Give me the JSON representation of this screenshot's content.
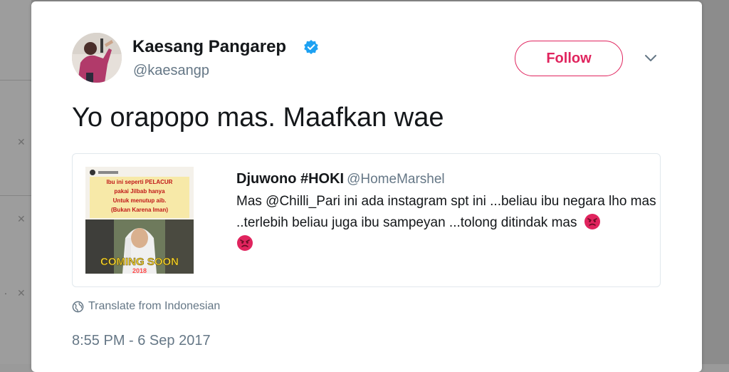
{
  "tweet": {
    "author_name": "Kaesang Pangarep",
    "author_handle": "@kaesangp",
    "follow_label": "Follow",
    "text": "Yo orapopo mas. Maafkan wae",
    "translate_label": "Translate from Indonesian",
    "timestamp": "8:55 PM - 6 Sep 2017"
  },
  "quoted_tweet": {
    "author_name": "Djuwono #HOKI",
    "author_handle": "@HomeMarshel",
    "text": "Mas @Chilli_Pari ini ada instagram spt ini ...beliau ibu negara lho mas ..terlebih beliau juga ibu sampeyan ...tolong ditindak mas",
    "image_caption_lines": [
      "Ibu ini seperti PELACUR",
      "pakai Jilbab hanya",
      "Untuk menutup aib.",
      "(Bukan Karena Iman)"
    ],
    "image_banner": "COMING SOON",
    "image_year": "2018"
  },
  "icons": {
    "verified": "verified-badge-icon",
    "caret": "chevron-down-icon",
    "globe": "globe-icon",
    "emoji": "angry-face-emoji"
  },
  "colors": {
    "accent": "#e0245e",
    "verified": "#1da1f2",
    "secondary_text": "#657786"
  }
}
